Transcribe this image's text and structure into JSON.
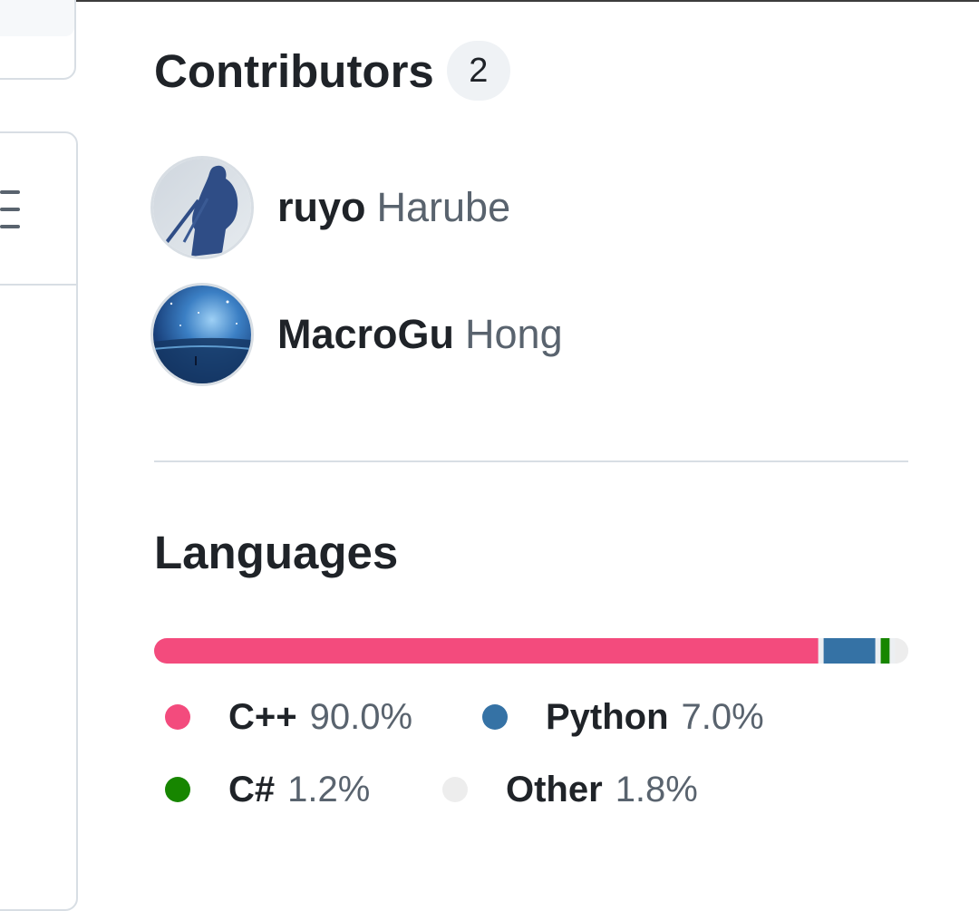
{
  "contributors": {
    "title": "Contributors",
    "count": "2",
    "people": [
      {
        "login": "ruyo",
        "name": "Harube"
      },
      {
        "login": "MacroGu",
        "name": "Hong"
      }
    ]
  },
  "languages": {
    "title": "Languages",
    "items": [
      {
        "name": "C++",
        "percent": "90.0%",
        "value": 90.0,
        "color": "#f34b7d"
      },
      {
        "name": "Python",
        "percent": "7.0%",
        "value": 7.0,
        "color": "#3572a5"
      },
      {
        "name": "C#",
        "percent": "1.2%",
        "value": 1.2,
        "color": "#178600"
      },
      {
        "name": "Other",
        "percent": "1.8%",
        "value": 1.8,
        "color": "#ededed"
      }
    ]
  },
  "icons": {
    "menu": "hamburger-menu-icon"
  }
}
